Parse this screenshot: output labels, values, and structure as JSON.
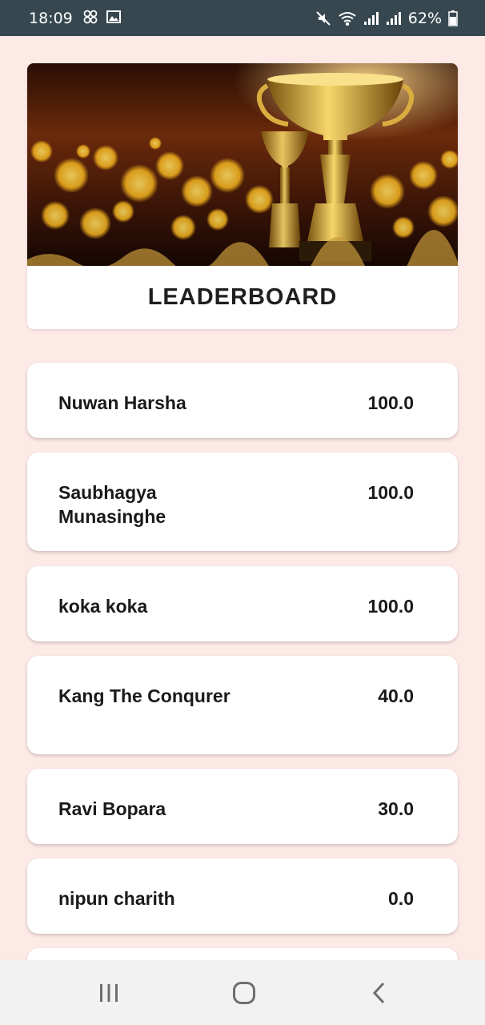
{
  "status_bar": {
    "time": "18:09",
    "battery": "62%",
    "icons": [
      "clover-icon",
      "gallery-icon",
      "mute-icon",
      "wifi-icon",
      "signal-icon",
      "signal-icon",
      "battery-icon"
    ]
  },
  "header": {
    "title": "LEADERBOARD",
    "image": "trophy-banner"
  },
  "leaderboard": [
    {
      "name": "Nuwan Harsha",
      "score": "100.0"
    },
    {
      "name": "Saubhagya Munasinghe",
      "score": "100.0"
    },
    {
      "name": "koka koka",
      "score": "100.0"
    },
    {
      "name": "Kang The Conqurer",
      "score": "40.0"
    },
    {
      "name": "Ravi Bopara",
      "score": "30.0"
    },
    {
      "name": "nipun charith",
      "score": "0.0"
    },
    {
      "name": "",
      "score": ""
    }
  ],
  "nav_bar": {
    "buttons": [
      "recent-apps-icon",
      "home-icon",
      "back-icon"
    ]
  },
  "colors": {
    "background": "#fde9e6",
    "status_bar": "#37474f",
    "card": "#ffffff",
    "nav_bar": "#f2f2f2"
  }
}
